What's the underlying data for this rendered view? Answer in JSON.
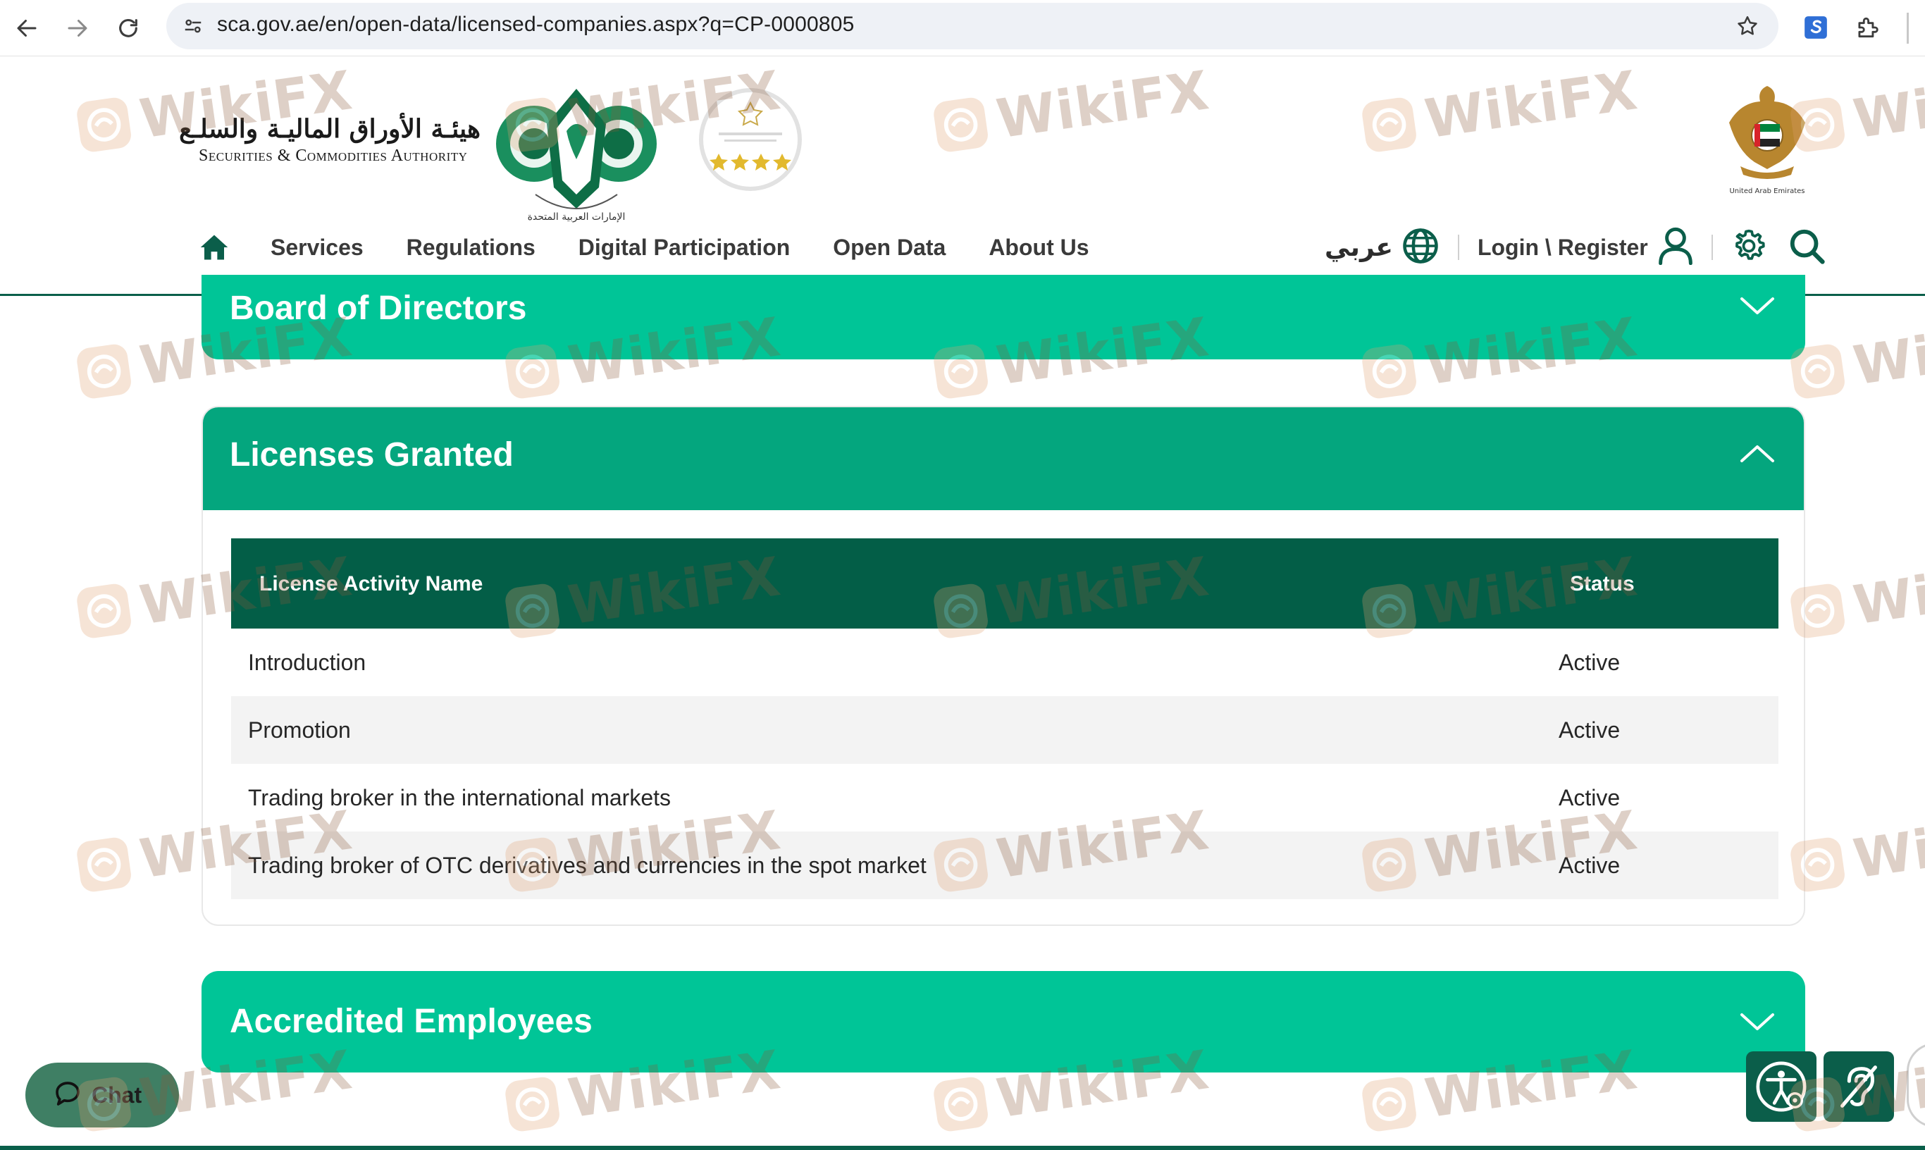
{
  "browser": {
    "url": "sca.gov.ae/en/open-data/licensed-companies.aspx?q=CP-0000805"
  },
  "header": {
    "logo_arabic": "هيئـة الأوراق الماليـة والسلـع",
    "logo_english": "Securities & Commodities Authority",
    "emblem_caption": "الإمارات العربية المتحدة",
    "uae_caption": "United Arab Emirates"
  },
  "nav": {
    "items": [
      "Services",
      "Regulations",
      "Digital Participation",
      "Open Data",
      "About Us"
    ],
    "language": "عربي",
    "login": "Login \\ Register"
  },
  "sections": {
    "board": "Board of Directors",
    "licenses": "Licenses Granted",
    "employees": "Accredited Employees"
  },
  "license_table": {
    "headers": [
      "License Activity Name",
      "Status"
    ],
    "rows": [
      {
        "activity": "Introduction",
        "status": "Active"
      },
      {
        "activity": "Promotion",
        "status": "Active"
      },
      {
        "activity": "Trading broker in the international markets",
        "status": "Active"
      },
      {
        "activity": "Trading broker of OTC derivatives and currencies in the spot market",
        "status": "Active"
      }
    ]
  },
  "widgets": {
    "chat": "Chat"
  },
  "watermark": "WikiFX",
  "colors": {
    "brand_green": "#00c597",
    "brand_green_dark": "#04a67e",
    "table_header": "#035e47",
    "nav_icon_green": "#0b5e4a"
  }
}
